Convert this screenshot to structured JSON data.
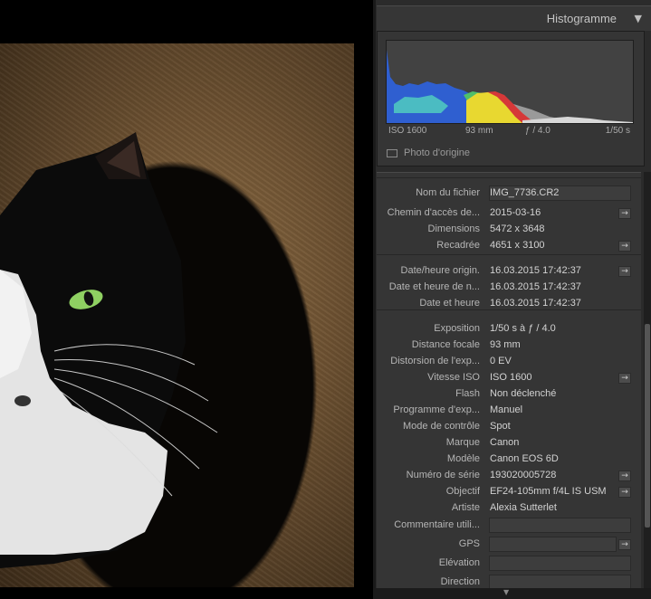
{
  "histogram": {
    "title": "Histogramme",
    "toggle_icon": "▼",
    "readout": {
      "iso": "ISO 1600",
      "focal": "93 mm",
      "aperture": "ƒ / 4.0",
      "shutter": "1/50 s"
    },
    "original_photo_label": "Photo d'origine",
    "colors": {
      "blue": "#2f5fd0",
      "cyan": "#4fc6c0",
      "yellow": "#e8d830",
      "red": "#d63838",
      "green": "#4fbf6a",
      "gray": "#9a9a9a"
    }
  },
  "metadata": {
    "rows": [
      {
        "label": "Nom du fichier",
        "value": "IMG_7736.CR2",
        "editable": true,
        "go": false
      },
      {
        "label": "Chemin d'accès de...",
        "value": "2015-03-16",
        "editable": false,
        "go": true
      },
      {
        "label": "Dimensions",
        "value": "5472 x 3648",
        "editable": false,
        "go": false
      },
      {
        "label": "Recadrée",
        "value": "4651 x 3100",
        "editable": false,
        "go": true
      },
      {
        "label": "Date/heure origin.",
        "value": "16.03.2015 17:42:37",
        "editable": false,
        "go": true
      },
      {
        "label": "Date et heure de n...",
        "value": "16.03.2015 17:42:37",
        "editable": false,
        "go": false
      },
      {
        "label": "Date et heure",
        "value": "16.03.2015 17:42:37",
        "editable": false,
        "go": false
      },
      {
        "label": "Exposition",
        "value": "1/50 s à ƒ / 4.0",
        "editable": false,
        "go": false
      },
      {
        "label": "Distance focale",
        "value": "93 mm",
        "editable": false,
        "go": false
      },
      {
        "label": "Distorsion de l'exp...",
        "value": "0 EV",
        "editable": false,
        "go": false
      },
      {
        "label": "Vitesse ISO",
        "value": "ISO 1600",
        "editable": false,
        "go": true
      },
      {
        "label": "Flash",
        "value": "Non déclenché",
        "editable": false,
        "go": false
      },
      {
        "label": "Programme d'exp...",
        "value": "Manuel",
        "editable": false,
        "go": false
      },
      {
        "label": "Mode de contrôle",
        "value": "Spot",
        "editable": false,
        "go": false
      },
      {
        "label": "Marque",
        "value": "Canon",
        "editable": false,
        "go": false
      },
      {
        "label": "Modèle",
        "value": "Canon EOS 6D",
        "editable": false,
        "go": false
      },
      {
        "label": "Numéro de série",
        "value": "193020005728",
        "editable": false,
        "go": true
      },
      {
        "label": "Objectif",
        "value": "EF24-105mm f/4L IS USM",
        "editable": false,
        "go": true
      },
      {
        "label": "Artiste",
        "value": "Alexia Sutterlet",
        "editable": false,
        "go": false
      },
      {
        "label": "Commentaire utili...",
        "value": "",
        "editable": true,
        "go": false
      },
      {
        "label": "GPS",
        "value": "",
        "editable": true,
        "go": true
      },
      {
        "label": "Elévation",
        "value": "",
        "editable": true,
        "go": false
      },
      {
        "label": "Direction",
        "value": "",
        "editable": true,
        "go": false
      }
    ],
    "go_icon": "→"
  },
  "photo": {
    "subject": "black and white cat with green eye inside round opening"
  }
}
